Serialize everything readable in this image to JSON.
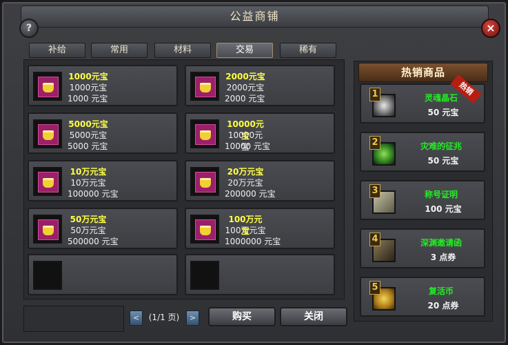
{
  "window": {
    "title": "公益商铺"
  },
  "tabs": [
    {
      "label": "补给"
    },
    {
      "label": "常用"
    },
    {
      "label": "材料"
    },
    {
      "label": "交易",
      "active": true
    },
    {
      "label": "稀有"
    }
  ],
  "items": [
    {
      "name": "1000元宝",
      "desc": "1000元宝",
      "price": "1000 元宝"
    },
    {
      "name": "2000元宝",
      "desc": "2000元宝",
      "price": "2000 元宝"
    },
    {
      "name": "5000元宝",
      "desc": "5000元宝",
      "price": "5000 元宝"
    },
    {
      "name": "10000元宝",
      "desc": "10000元宝",
      "price": "10000 元宝"
    },
    {
      "name": "10万元宝",
      "desc": "10万元宝",
      "price": "100000 元宝"
    },
    {
      "name": "20万元宝",
      "desc": "20万元宝",
      "price": "200000 元宝"
    },
    {
      "name": "50万元宝",
      "desc": "50万元宝",
      "price": "500000 元宝"
    },
    {
      "name": "100万元宝",
      "desc": "100万元宝",
      "price": "1000000 元宝"
    }
  ],
  "hot": {
    "title": "热销商品",
    "badge": "热销",
    "items": [
      {
        "num": "1",
        "name": "灵魂晶石",
        "price": "50 元宝",
        "icon": "crystal-icon"
      },
      {
        "num": "2",
        "name": "灾难的征兆",
        "price": "50 元宝",
        "icon": "orb-icon"
      },
      {
        "num": "3",
        "name": "称号证明",
        "price": "100 元宝",
        "icon": "scroll-icon"
      },
      {
        "num": "4",
        "name": "深渊邀请函",
        "price": "3 点券",
        "icon": "letter-icon"
      },
      {
        "num": "5",
        "name": "复活币",
        "price": "20 点券",
        "icon": "coin-icon"
      }
    ]
  },
  "pager": {
    "text": "(1/1 页)",
    "prev": "<",
    "next": ">"
  },
  "buttons": {
    "buy": "购买",
    "close": "关闭"
  },
  "icons": {
    "help": "?",
    "close": "×"
  },
  "colors": {
    "item_name": "#ffff44",
    "hot_name": "#22ee22",
    "title_text": "#f2e6c8"
  }
}
